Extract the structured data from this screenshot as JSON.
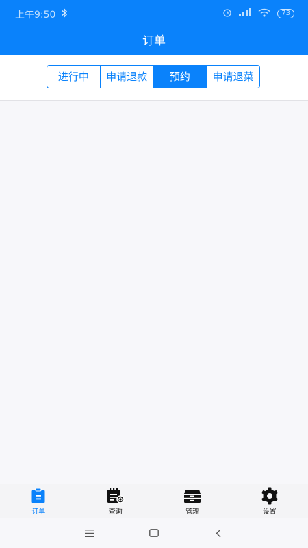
{
  "status_bar": {
    "time": "上午9:50",
    "battery": "73",
    "icons": [
      "bluetooth-icon",
      "alarm-icon",
      "signal-icon",
      "wifi-icon",
      "battery-icon"
    ]
  },
  "header": {
    "title": "订单"
  },
  "tabs": [
    {
      "label": "进行中"
    },
    {
      "label": "申请退款"
    },
    {
      "label": "预约",
      "active": true
    },
    {
      "label": "申请退菜"
    }
  ],
  "bottom_nav": [
    {
      "label": "订单",
      "icon": "clipboard-icon",
      "active": true
    },
    {
      "label": "查询",
      "icon": "calendar-search-icon"
    },
    {
      "label": "管理",
      "icon": "cabinet-icon"
    },
    {
      "label": "设置",
      "icon": "gear-icon"
    }
  ],
  "system_nav": {
    "icons": [
      "menu-icon",
      "home-icon",
      "back-icon"
    ]
  },
  "colors": {
    "primary": "#0a82fb",
    "background": "#f7f7fa",
    "text_dark": "#222222"
  }
}
